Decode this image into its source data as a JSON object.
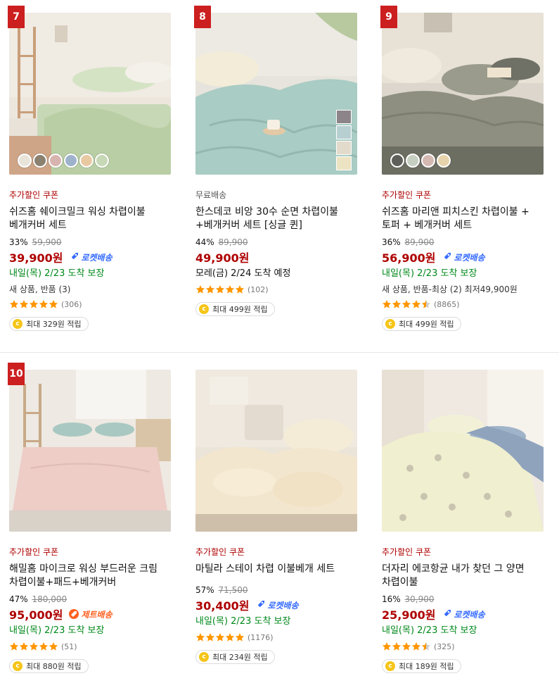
{
  "products": [
    {
      "rank": "7",
      "badge": "추가할인 쿠폰",
      "title": "쉬즈홈 쉐이크밀크 워싱 차렵이불 베개커버 세트",
      "discount": "33%",
      "original_price": "59,900",
      "sale_price": "39,900원",
      "shipping": "로켓배송",
      "delivery": "내일(목) 2/23 도착 보장",
      "extra": "새 상품, 반품 (3)",
      "rating_count": "(306)",
      "rating": 5,
      "cashback": "최대 329원 적립"
    },
    {
      "rank": "8",
      "badge": "무료배송",
      "title": "한스데코 비앙 30수 순면 차렵이불+베개커버 세트 [싱글 퀸]",
      "discount": "44%",
      "original_price": "89,900",
      "sale_price": "49,900원",
      "shipping": "",
      "delivery": "모레(금) 2/24 도착 예정",
      "extra": "",
      "rating_count": "(102)",
      "rating": 5,
      "cashback": "최대 499원 적립"
    },
    {
      "rank": "9",
      "badge": "추가할인 쿠폰",
      "title": "쉬즈홈 마리앤 피치스킨 차렵이불 + 토퍼 + 베개커버 세트",
      "discount": "36%",
      "original_price": "89,900",
      "sale_price": "56,900원",
      "shipping": "로켓배송",
      "delivery": "내일(목) 2/23 도착 보장",
      "extra": "새 상품, 반품-최상 (2) 최저49,900원",
      "rating_count": "(8865)",
      "rating": 4.5,
      "cashback": "최대 499원 적립"
    },
    {
      "rank": "10",
      "badge": "추가할인 쿠폰",
      "title": "해밀홈 마이크로 워싱 부드러운 크림 차렵이불+패드+베개커버",
      "discount": "47%",
      "original_price": "180,000",
      "sale_price": "95,000원",
      "shipping": "제트배송",
      "delivery": "내일(목) 2/23 도착 보장",
      "extra": "",
      "rating_count": "(51)",
      "rating": 5,
      "cashback": "최대 880원 적립"
    },
    {
      "rank": "",
      "badge": "추가할인 쿠폰",
      "title": "마틸라 스테이 차렵 이불베개 세트",
      "discount": "57%",
      "original_price": "71,500",
      "sale_price": "30,400원",
      "shipping": "로켓배송",
      "delivery": "내일(목) 2/23 도착 보장",
      "extra": "",
      "rating_count": "(1176)",
      "rating": 5,
      "cashback": "최대 234원 적립"
    },
    {
      "rank": "",
      "badge": "추가할인 쿠폰",
      "title": "더자리 에코항균 내가 찾던 그 양면 차렵이불",
      "discount": "16%",
      "original_price": "30,900",
      "sale_price": "25,900원",
      "shipping": "로켓배송",
      "delivery": "내일(목) 2/23 도착 보장",
      "extra": "",
      "rating_count": "(325)",
      "rating": 4.5,
      "cashback": "최대 189원 적립"
    }
  ],
  "coin_glyph": "c",
  "colors": {
    "accent_red": "#ae0000",
    "rank_red": "#cc1f1f",
    "rocket_blue": "#346aff",
    "jet_orange": "#ff5f1f",
    "delivery_green": "#00891a",
    "star_orange": "#ff9600"
  }
}
